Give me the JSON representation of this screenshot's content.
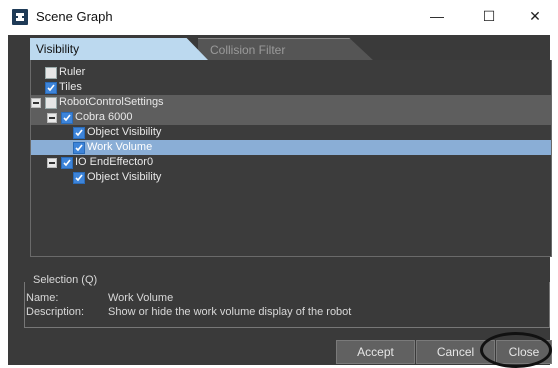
{
  "window": {
    "title": "Scene Graph"
  },
  "window_controls": {
    "minimize": "—",
    "maximize": "☐",
    "close": "✕"
  },
  "tabs": [
    {
      "label": "Visibility",
      "active": true
    },
    {
      "label": "Collision Filter",
      "active": false
    }
  ],
  "tree": [
    {
      "label": "Ruler",
      "checked": false,
      "expandable": false
    },
    {
      "label": "Tiles",
      "checked": true,
      "expandable": false
    },
    {
      "label": "RobotControlSettings",
      "checked": false,
      "expandable": true
    },
    {
      "label": "Cobra 6000",
      "checked": true,
      "expandable": true
    },
    {
      "label": "Object Visibility",
      "checked": true,
      "expandable": false
    },
    {
      "label": "Work Volume",
      "checked": true,
      "expandable": false,
      "selected": true
    },
    {
      "label": "IO EndEffector0",
      "checked": true,
      "expandable": true
    },
    {
      "label": "Object Visibility",
      "checked": true,
      "expandable": false
    }
  ],
  "selection": {
    "legend": "Selection (Q)",
    "name_label": "Name:",
    "name_value": "Work Volume",
    "description_label": "Description:",
    "description_value": "Show or hide the work volume display of the robot"
  },
  "buttons": {
    "accept": "Accept",
    "cancel": "Cancel",
    "close": "Close"
  },
  "colors": {
    "dialog_bg": "#3a3a3a",
    "selected_row": "#8aaed6",
    "checkbox_checked": "#3d84d9",
    "active_tab": "#bcd9ef"
  }
}
